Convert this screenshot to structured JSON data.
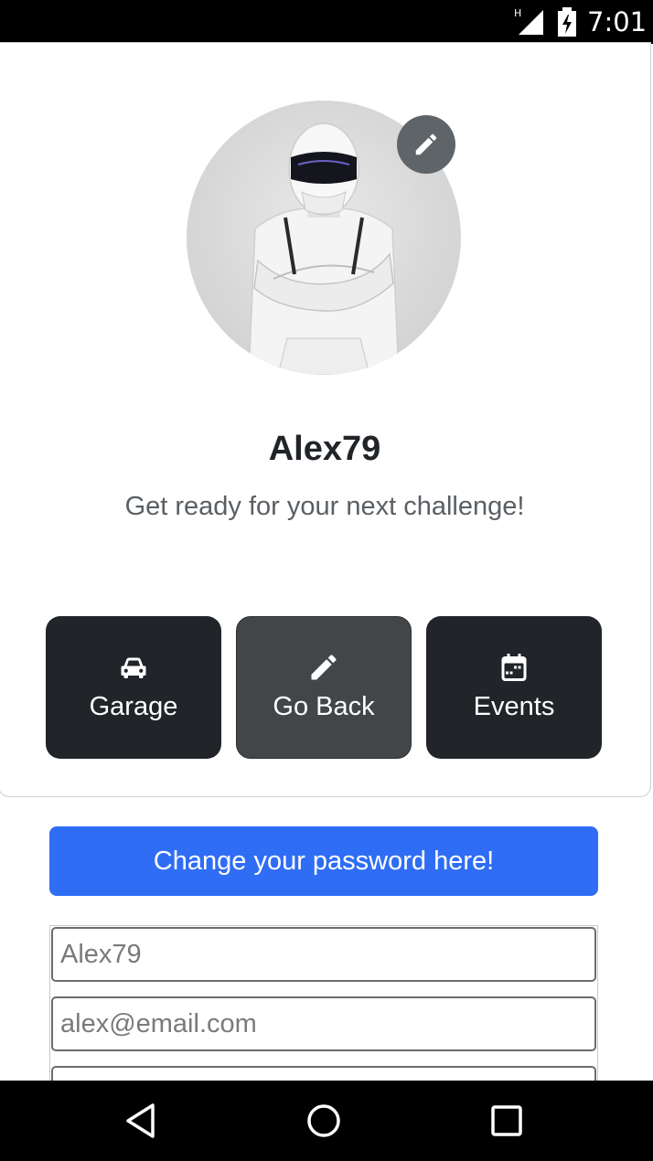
{
  "status_bar": {
    "network_type": "H",
    "time": "7:01"
  },
  "profile": {
    "username": "Alex79",
    "tagline": "Get ready for your next challenge!"
  },
  "actions": {
    "garage_label": "Garage",
    "go_back_label": "Go Back",
    "events_label": "Events"
  },
  "change_password_label": "Change your password here!",
  "form": {
    "username_value": "Alex79",
    "email_value": "alex@email.com"
  },
  "icons": {
    "edit": "pencil-icon",
    "garage": "car-icon",
    "go_back": "pencil-icon",
    "events": "calendar-icon"
  },
  "colors": {
    "dark_button": "#212529",
    "active_button": "#424649",
    "primary": "#2f6df5"
  }
}
